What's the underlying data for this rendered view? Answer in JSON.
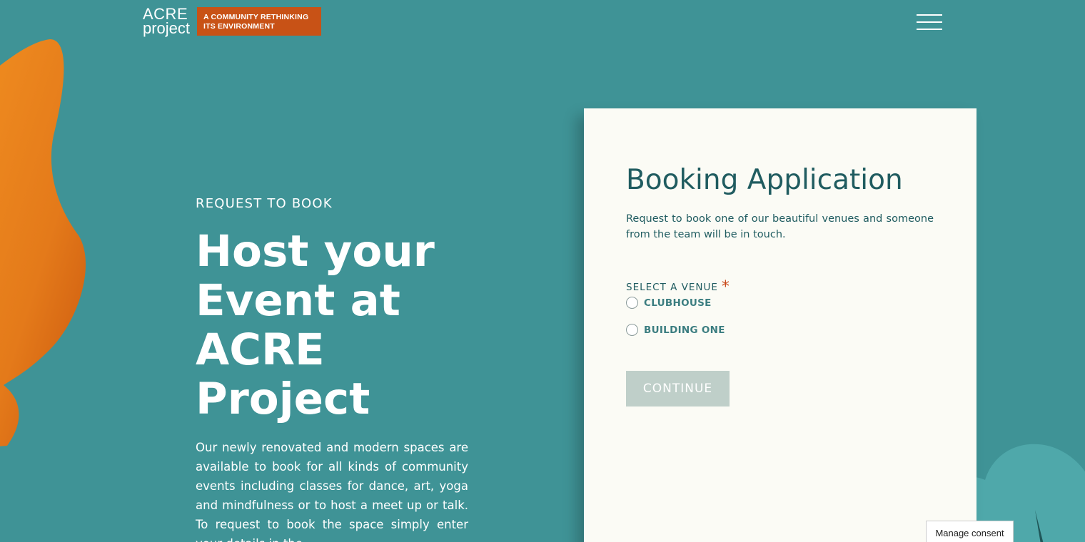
{
  "header": {
    "logo_line1": "ACRE",
    "logo_line2": "project",
    "logo_tagline": "A COMMUNITY RETHINKING ITS ENVIRONMENT"
  },
  "hero": {
    "eyebrow": "REQUEST TO BOOK",
    "title": "Host your Event at ACRE Project",
    "body": "Our newly renovated and modern spaces are available to book for all kinds of community events including classes for dance, art, yoga and mindfulness or to host a meet up or talk. To request to book the space simply enter your details in the"
  },
  "booking": {
    "title": "Booking Application",
    "description": "Request to book one of our beautiful venues and someone from the team will be in touch.",
    "venue_label": "SELECT A VENUE",
    "required_mark": "*",
    "venues": [
      {
        "label": "CLUBHOUSE",
        "selected": false
      },
      {
        "label": "BUILDING ONE",
        "selected": false
      }
    ],
    "continue_label": "CONTINUE"
  },
  "consent": {
    "label": "Manage consent"
  },
  "colors": {
    "background": "#3f9396",
    "accent_orange": "#c85216",
    "card": "#fbfbf5",
    "heading": "#205c60",
    "button_disabled": "#bfcfc9"
  }
}
